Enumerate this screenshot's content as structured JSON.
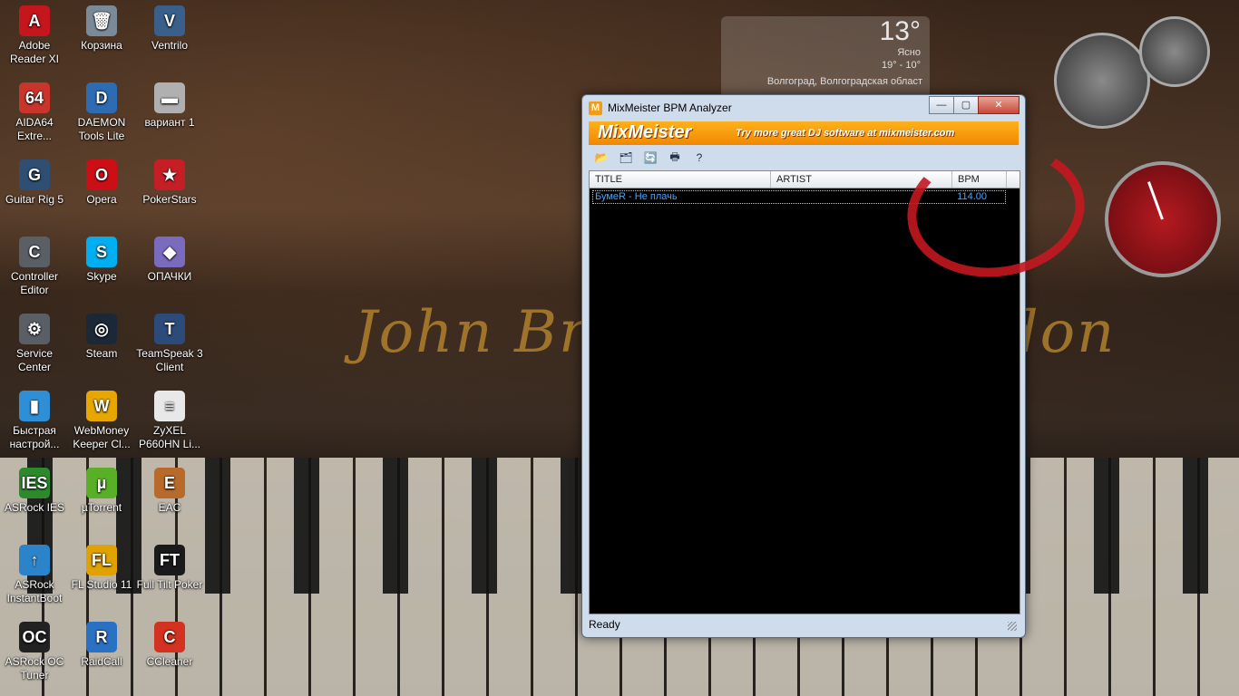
{
  "desktop": {
    "icons": [
      {
        "label": "Adobe Reader XI",
        "glyph": "A",
        "color": "#c4161c"
      },
      {
        "label": "Корзина",
        "glyph": "🗑",
        "color": "#7b8a99"
      },
      {
        "label": "Ventrilo",
        "glyph": "V",
        "color": "#3a5f8a"
      },
      {
        "label": "AIDA64 Extre...",
        "glyph": "64",
        "color": "#c9352b"
      },
      {
        "label": "DAEMON Tools Lite",
        "glyph": "D",
        "color": "#2d6bb3"
      },
      {
        "label": "вариант 1",
        "glyph": "▬",
        "color": "#b0b0b0"
      },
      {
        "label": "Guitar Rig 5",
        "glyph": "G",
        "color": "#2e4f73"
      },
      {
        "label": "Opera",
        "glyph": "O",
        "color": "#cc0f16"
      },
      {
        "label": "PokerStars",
        "glyph": "★",
        "color": "#c51f25"
      },
      {
        "label": "Controller Editor",
        "glyph": "C",
        "color": "#5a5f66"
      },
      {
        "label": "Skype",
        "glyph": "S",
        "color": "#00aff0"
      },
      {
        "label": "ОПАЧКИ",
        "glyph": "◆",
        "color": "#7a6bbf"
      },
      {
        "label": "Service Center",
        "glyph": "⚙",
        "color": "#5a5f66"
      },
      {
        "label": "Steam",
        "glyph": "◎",
        "color": "#1b2838"
      },
      {
        "label": "TeamSpeak 3 Client",
        "glyph": "T",
        "color": "#2c4a7a"
      },
      {
        "label": "Быстрая настрой...",
        "glyph": "▮",
        "color": "#2e8fd6"
      },
      {
        "label": "WebMoney Keeper Cl...",
        "glyph": "W",
        "color": "#e7a600"
      },
      {
        "label": "ZyXEL P660HN Li...",
        "glyph": "≡",
        "color": "#e8e8e8"
      },
      {
        "label": "ASRock IES",
        "glyph": "IES",
        "color": "#2c8a2c"
      },
      {
        "label": "µTorrent",
        "glyph": "µ",
        "color": "#59b026"
      },
      {
        "label": "EAC",
        "glyph": "E",
        "color": "#b86a2a"
      },
      {
        "label": "ASRock InstantBoot",
        "glyph": "↑",
        "color": "#2b84c9"
      },
      {
        "label": "FL Studio 11",
        "glyph": "FL",
        "color": "#e0a200"
      },
      {
        "label": "Full Tilt Poker",
        "glyph": "FT",
        "color": "#1a1a1a"
      },
      {
        "label": "ASRock OC Tuner",
        "glyph": "OC",
        "color": "#222"
      },
      {
        "label": "RaidCall",
        "glyph": "R",
        "color": "#2a71c4"
      },
      {
        "label": "CCleaner",
        "glyph": "C",
        "color": "#d2321f"
      }
    ]
  },
  "weather": {
    "temp": "13°",
    "condition": "Ясно",
    "range": "19° - 10°",
    "location": "Волгоград, Волгоградская област"
  },
  "window": {
    "title": "MixMeister BPM Analyzer",
    "app_icon_letter": "M",
    "buttons": {
      "minimize": "—",
      "maximize": "▢",
      "close": "✕"
    },
    "banner": {
      "logo": "MixMeister",
      "tagline": "Try more great DJ software at mixmeister.com"
    },
    "toolbar": [
      {
        "name": "open-folder-icon",
        "glyph": "📂"
      },
      {
        "name": "add-folder-icon",
        "glyph": "🗂"
      },
      {
        "name": "refresh-icon",
        "glyph": "🔄"
      },
      {
        "name": "print-icon",
        "glyph": "🖶"
      },
      {
        "name": "help-icon",
        "glyph": "?"
      }
    ],
    "columns": {
      "title": "TITLE",
      "artist": "ARTIST",
      "bpm": "BPM"
    },
    "rows": [
      {
        "title": "БумеR - Не плачь",
        "artist": "",
        "bpm": "114.00"
      }
    ],
    "status": "Ready"
  }
}
